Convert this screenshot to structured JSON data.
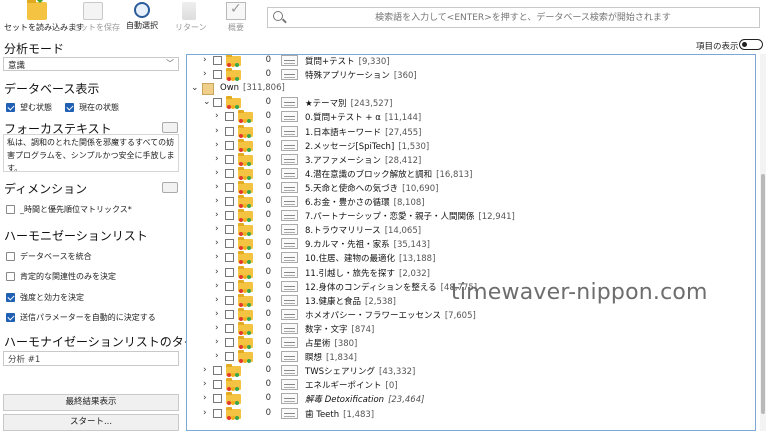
{
  "toolbar": {
    "load_label": "セットを読み込みます",
    "save_label": "セットを保存",
    "autoselect_label": "自動選択",
    "return_label": "リターン",
    "summary_label": "概要",
    "search_placeholder": "検索語を入力して<ENTER>を押すと、データベース検索が開始されます"
  },
  "left": {
    "analysis_mode_title": "分析モード",
    "analysis_mode_value": "意識",
    "database_title": "データベース表示",
    "db_opt1": "望む状態",
    "db_opt2": "現在の状態",
    "focus_title": "フォーカステキスト",
    "focus_text": "私は、調和のとれた関係を邪魔するすべての妨害プログラムを、シンプルかつ安全に手放します。",
    "dimension_title": "ディメンション",
    "dimension_opt": "_時間と優先順位マトリックス*",
    "harmonization_title": "ハーモニゼーションリスト",
    "harm_opt1": "データベースを統合",
    "harm_opt2": "肯定的な関連性のみを決定",
    "harm_opt3": "強度と効力を決定",
    "harm_opt4": "送信パラメーターを自動的に決定する",
    "harm_list_title": "ハーモナイゼーションリストのタイトル",
    "harm_list_title_value": "分析 #1",
    "final_result_button": "最終結果表示",
    "start_button": "スタート..."
  },
  "right": {
    "toggle_label": "項目の表示",
    "own_label": "Own",
    "own_count": "[311,806]",
    "tree_rows": [
      {
        "count": "0",
        "name": "質問+テスト",
        "num": "[9,330]"
      },
      {
        "count": "0",
        "name": "特殊アプリケーション",
        "num": "[360]"
      },
      {
        "count": "0",
        "name": "★テーマ別",
        "num": "[243,527]"
      },
      {
        "count": "0",
        "name": "0.質問+テスト + α",
        "num": "[11,144]"
      },
      {
        "count": "0",
        "name": "1.日本語キーワード",
        "num": "[27,455]"
      },
      {
        "count": "0",
        "name": "2.メッセージ[SpiTech]",
        "num": "[1,530]"
      },
      {
        "count": "0",
        "name": "3.アファメーション",
        "num": "[28,412]"
      },
      {
        "count": "0",
        "name": "4.潜在意識のブロック解放と調和",
        "num": "[16,813]"
      },
      {
        "count": "0",
        "name": "5.天命と使命への気づき",
        "num": "[10,690]"
      },
      {
        "count": "0",
        "name": "6.お金・豊かさの循環",
        "num": "[8,108]"
      },
      {
        "count": "0",
        "name": "7.パートナーシップ・恋愛・親子・人間関係",
        "num": "[12,941]"
      },
      {
        "count": "0",
        "name": "8.トラウマリリース",
        "num": "[14,065]"
      },
      {
        "count": "0",
        "name": "9.カルマ・先祖・家系",
        "num": "[35,143]"
      },
      {
        "count": "0",
        "name": "10.住居、建物の最適化",
        "num": "[13,188]"
      },
      {
        "count": "0",
        "name": "11.引越し・旅先を探す",
        "num": "[2,032]"
      },
      {
        "count": "0",
        "name": "12.身体のコンディションを整える",
        "num": "[48,775]"
      },
      {
        "count": "0",
        "name": "13.健康と食品",
        "num": "[2,538]"
      },
      {
        "count": "0",
        "name": "ホメオパシー・フラワーエッセンス",
        "num": "[7,605]"
      },
      {
        "count": "0",
        "name": "数字・文字",
        "num": "[874]"
      },
      {
        "count": "0",
        "name": "占星術",
        "num": "[380]"
      },
      {
        "count": "0",
        "name": "瞑想",
        "num": "[1,834]"
      },
      {
        "count": "0",
        "name": "TWSシェアリング",
        "num": "[43,332]"
      },
      {
        "count": "0",
        "name": "エネルギーポイント",
        "num": "[0]"
      },
      {
        "count": "0",
        "name": "解毒 Detoxification",
        "num": "[23,464]"
      },
      {
        "count": "0",
        "name": "歯 Teeth",
        "num": "[1,483]"
      }
    ]
  },
  "watermark": "timewaver-nippon.com",
  "colors": {
    "accent": "#1f5fb4",
    "folder": "#f5c342",
    "tree_border": "#7aa9d8"
  }
}
